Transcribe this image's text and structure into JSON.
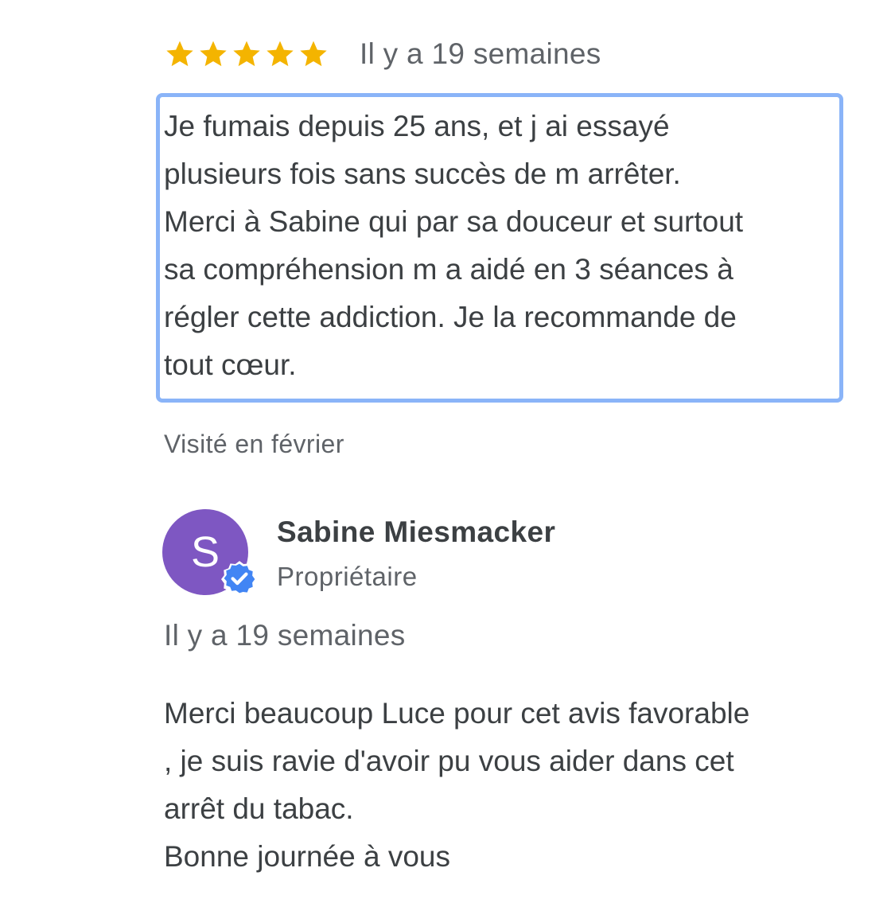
{
  "review": {
    "rating": 5,
    "max_rating": 5,
    "star_color": "#f4b400",
    "date": "Il y a 19 semaines",
    "text": "Je fumais depuis 25 ans, et j ai essayé\nplusieurs fois sans succès de m arrêter.\nMerci à Sabine qui par sa douceur et surtout\nsa compréhension m a aidé en 3 séances à\nrégler cette addiction. Je la recommande de\ntout cœur.",
    "highlight_color": "#8ab4f8",
    "visit": "Visité en février"
  },
  "owner_reply": {
    "avatar_letter": "S",
    "avatar_color": "#7e57c2",
    "verified_badge_color": "#4285f4",
    "name": "Sabine Miesmacker",
    "role": "Propriétaire",
    "date": "Il y a 19 semaines",
    "text": "Merci beaucoup Luce pour cet avis favorable\n, je suis ravie d'avoir pu vous aider dans cet\narrêt du tabac.\nBonne journée à vous"
  }
}
